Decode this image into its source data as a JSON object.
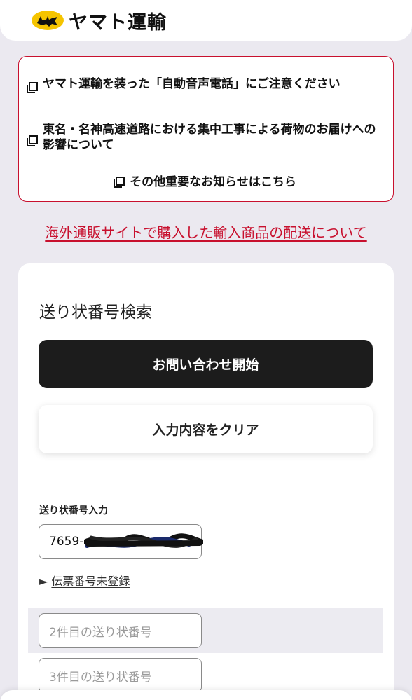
{
  "header": {
    "logo_icon": "black-cat-logo-icon",
    "brand": "ヤマト運輸",
    "accent_color": "#f5c400"
  },
  "notices": {
    "border_color": "#c8102e",
    "items": [
      {
        "label": "ヤマト運輸を装った「自動音声電話」にご注意ください",
        "icon": "external-link-icon"
      },
      {
        "label": "東名・名神高速道路における集中工事による荷物のお届けへの影響について",
        "icon": "external-link-icon"
      },
      {
        "label": "その他重要なお知らせはこちら",
        "icon": "external-link-icon"
      }
    ]
  },
  "overseas_link": "海外通販サイトで購入した輸入商品の配送について",
  "search": {
    "title": "送り状番号検索",
    "start_button": "お問い合わせ開始",
    "clear_button": "入力内容をクリア",
    "input_label": "送り状番号入力",
    "field_1_value": "7659-",
    "unregistered_marker": "►",
    "unregistered_link": "伝票番号未登録",
    "field_2_placeholder": "2件目の送り状番号",
    "field_3_placeholder": "3件目の送り状番号"
  }
}
